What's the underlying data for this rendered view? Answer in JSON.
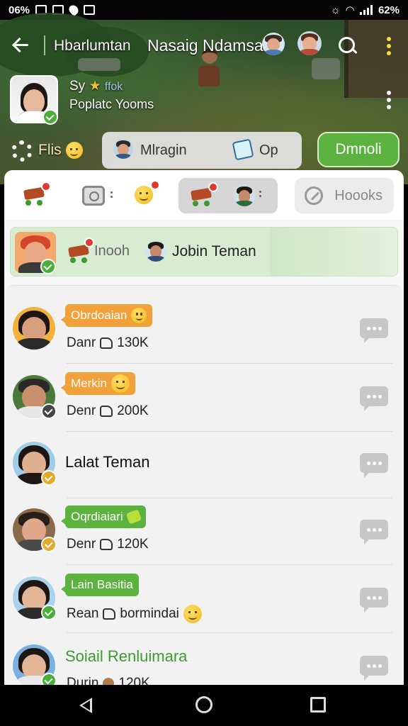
{
  "status_bar": {
    "left_text": "06%",
    "battery": "62%"
  },
  "header": {
    "title": "Hbarlumtan",
    "subtitle": "Nasaig Ndamsai",
    "profile_line1_prefix": "Sy",
    "profile_line1_suffix": "ffok",
    "profile_line2": "Poplatc Yooms",
    "filter_label": "Flis",
    "segment_left_label": "Mlragin",
    "segment_right_label": "Op",
    "action_button_label": "Dmnoli"
  },
  "toolbar": {
    "hooks_button_label": "Hoooks"
  },
  "friend_bar": {
    "label1": "Inooh",
    "label2": "Jobin Teman"
  },
  "list_items": [
    {
      "tag": "Obrdoaian",
      "tag_color": "orange",
      "meta_prefix": "Danr",
      "meta_value": "130K"
    },
    {
      "tag": "Merkin",
      "tag_color": "orange",
      "meta_prefix": "Denr",
      "meta_value": "200K"
    },
    {
      "title": "Lalat Teman"
    },
    {
      "tag": "Oqrdiaiari",
      "tag_color": "green",
      "meta_prefix": "Denr",
      "meta_value": "120K"
    },
    {
      "tag": "Lain Basitia",
      "tag_color": "green",
      "meta_prefix": "Rean",
      "meta_value": "bormindai"
    },
    {
      "title": "Soiail Renluimara",
      "meta_prefix": "Durin",
      "meta_value": "120K"
    }
  ],
  "colors": {
    "accent_green": "#5cb23f",
    "accent_orange": "#f2a13a",
    "badge_red": "#e03a2e"
  }
}
